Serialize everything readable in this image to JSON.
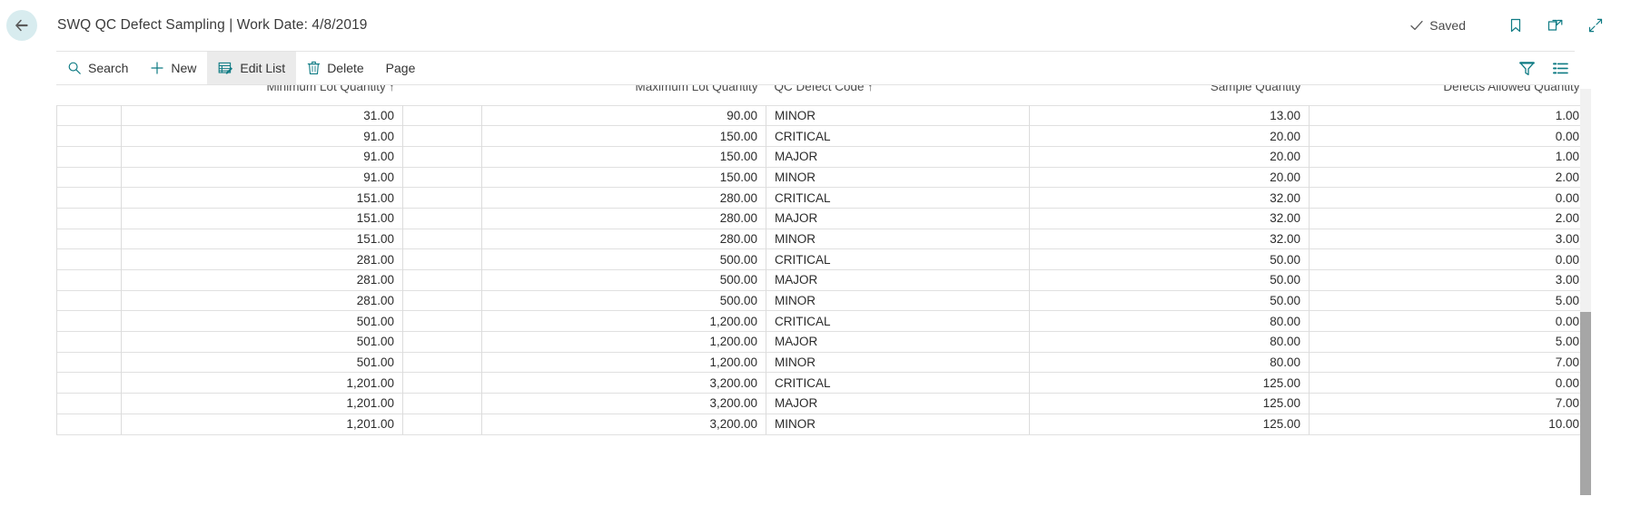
{
  "header": {
    "back_label": "Back",
    "title": "SWQ QC Defect Sampling | Work Date: 4/8/2019",
    "saved_label": "Saved",
    "bookmark_label": "Bookmark",
    "open_new_window_label": "Open in new window",
    "collapse_label": "Collapse"
  },
  "toolbar": {
    "search_label": "Search",
    "new_label": "New",
    "edit_list_label": "Edit List",
    "delete_label": "Delete",
    "page_label": "Page",
    "filter_label": "Filter",
    "options_label": "Options"
  },
  "grid": {
    "columns": [
      {
        "key": "select",
        "label": "",
        "align": "left",
        "sorted": false
      },
      {
        "key": "min_lot",
        "label": "Minimum Lot Quantity",
        "align": "right",
        "sorted": true
      },
      {
        "key": "gap",
        "label": "",
        "align": "right",
        "sorted": false
      },
      {
        "key": "max_lot",
        "label": "Maximum Lot Quantity",
        "align": "right",
        "sorted": false
      },
      {
        "key": "code",
        "label": "QC Defect Code",
        "align": "left",
        "sorted": true
      },
      {
        "key": "sample",
        "label": "Sample Quantity",
        "align": "right",
        "sorted": false
      },
      {
        "key": "defects",
        "label": "Defects Allowed Quantity",
        "align": "right",
        "sorted": false
      }
    ],
    "sort_arrow": "↑",
    "rows": [
      {
        "min_lot": "31.00",
        "max_lot": "90.00",
        "code": "MINOR",
        "sample": "13.00",
        "defects": "1.00"
      },
      {
        "min_lot": "91.00",
        "max_lot": "150.00",
        "code": "CRITICAL",
        "sample": "20.00",
        "defects": "0.00"
      },
      {
        "min_lot": "91.00",
        "max_lot": "150.00",
        "code": "MAJOR",
        "sample": "20.00",
        "defects": "1.00"
      },
      {
        "min_lot": "91.00",
        "max_lot": "150.00",
        "code": "MINOR",
        "sample": "20.00",
        "defects": "2.00"
      },
      {
        "min_lot": "151.00",
        "max_lot": "280.00",
        "code": "CRITICAL",
        "sample": "32.00",
        "defects": "0.00"
      },
      {
        "min_lot": "151.00",
        "max_lot": "280.00",
        "code": "MAJOR",
        "sample": "32.00",
        "defects": "2.00"
      },
      {
        "min_lot": "151.00",
        "max_lot": "280.00",
        "code": "MINOR",
        "sample": "32.00",
        "defects": "3.00"
      },
      {
        "min_lot": "281.00",
        "max_lot": "500.00",
        "code": "CRITICAL",
        "sample": "50.00",
        "defects": "0.00"
      },
      {
        "min_lot": "281.00",
        "max_lot": "500.00",
        "code": "MAJOR",
        "sample": "50.00",
        "defects": "3.00"
      },
      {
        "min_lot": "281.00",
        "max_lot": "500.00",
        "code": "MINOR",
        "sample": "50.00",
        "defects": "5.00"
      },
      {
        "min_lot": "501.00",
        "max_lot": "1,200.00",
        "code": "CRITICAL",
        "sample": "80.00",
        "defects": "0.00"
      },
      {
        "min_lot": "501.00",
        "max_lot": "1,200.00",
        "code": "MAJOR",
        "sample": "80.00",
        "defects": "5.00"
      },
      {
        "min_lot": "501.00",
        "max_lot": "1,200.00",
        "code": "MINOR",
        "sample": "80.00",
        "defects": "7.00"
      },
      {
        "min_lot": "1,201.00",
        "max_lot": "3,200.00",
        "code": "CRITICAL",
        "sample": "125.00",
        "defects": "0.00"
      },
      {
        "min_lot": "1,201.00",
        "max_lot": "3,200.00",
        "code": "MAJOR",
        "sample": "125.00",
        "defects": "7.00"
      },
      {
        "min_lot": "1,201.00",
        "max_lot": "3,200.00",
        "code": "MINOR",
        "sample": "125.00",
        "defects": "10.00"
      }
    ]
  },
  "colors": {
    "accent": "#0f7b84",
    "back_circle": "#d8ecef",
    "toolbar_active": "#ebebeb",
    "grid_line": "#dcdcdc",
    "scroll_thumb": "#a6a6a6"
  }
}
